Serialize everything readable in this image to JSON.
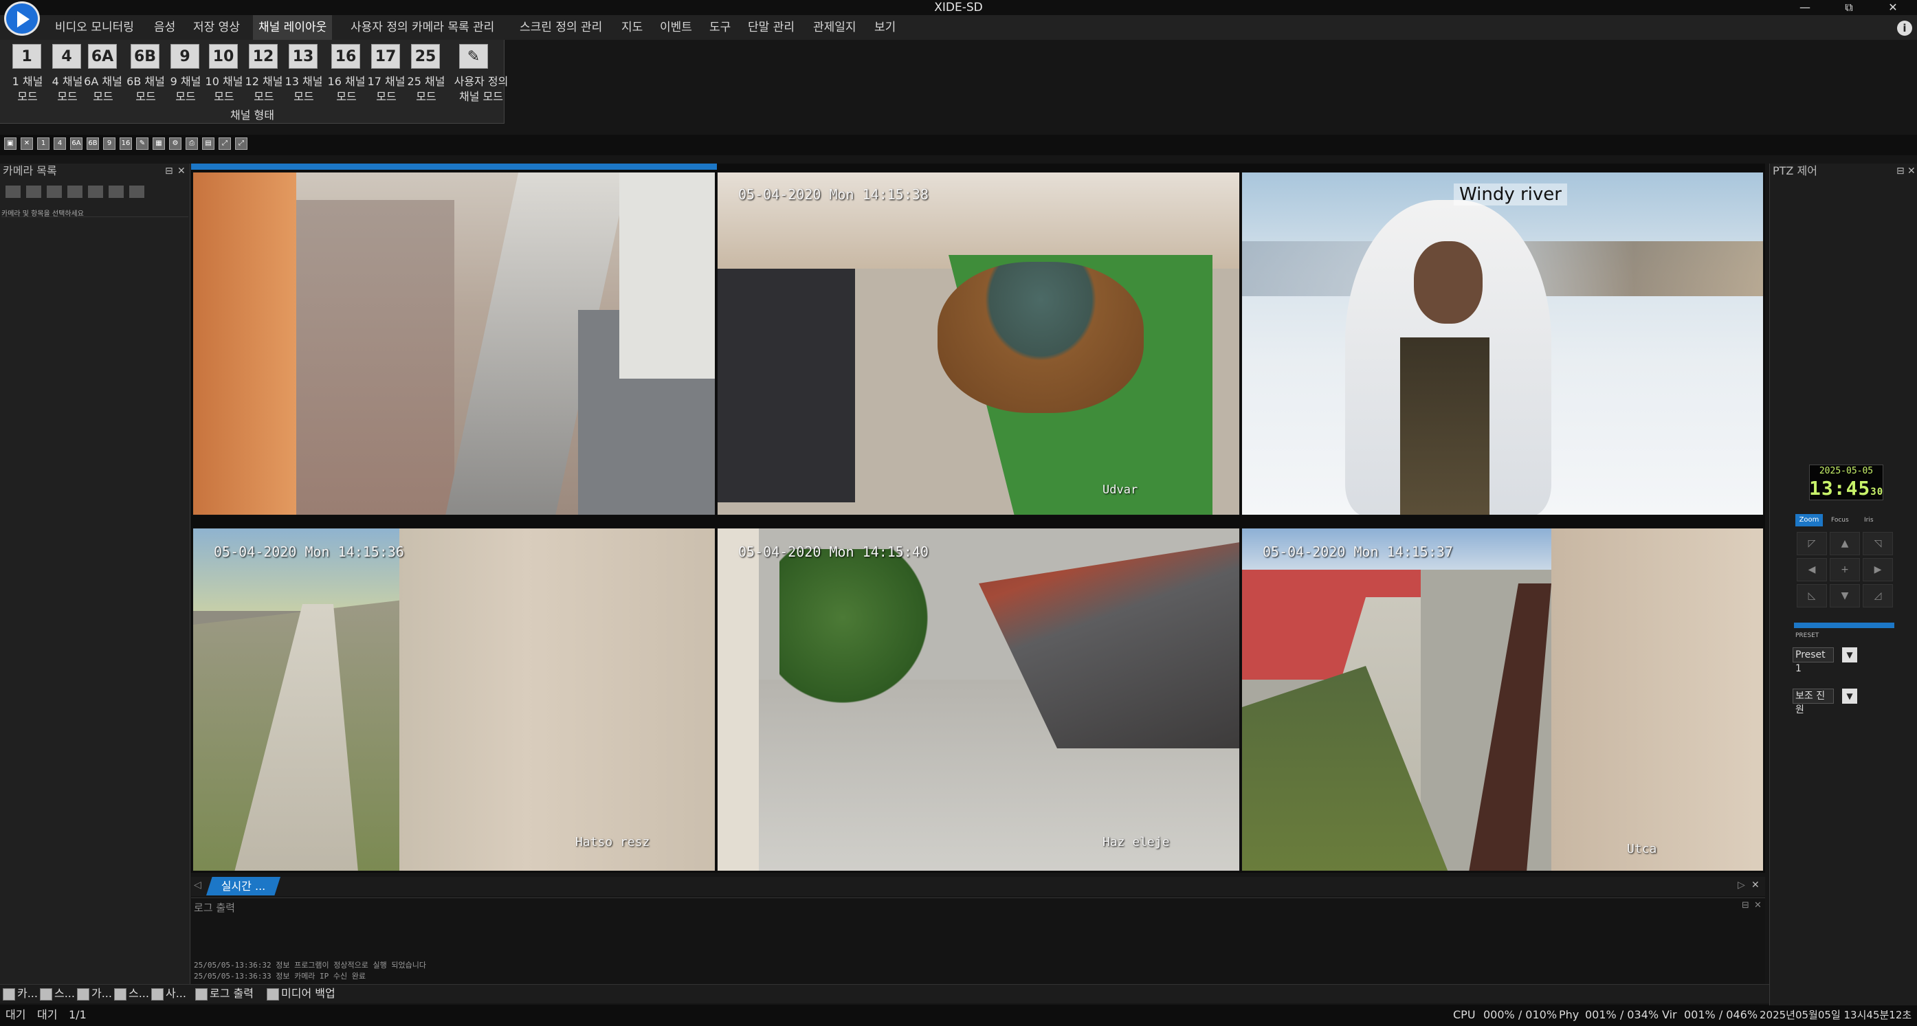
{
  "window": {
    "title": "XIDE-SD",
    "minimize": "—",
    "maximize": "⧉",
    "close": "✕"
  },
  "menu": [
    {
      "label": "비디오 모니터링"
    },
    {
      "label": "음성"
    },
    {
      "label": "저장 영상"
    },
    {
      "label": "채널 레이아웃",
      "active": true
    },
    {
      "label": "사용자 정의 카메라 목록 관리"
    },
    {
      "label": "스크린 정의 관리"
    },
    {
      "label": "지도"
    },
    {
      "label": "이벤트"
    },
    {
      "label": "도구"
    },
    {
      "label": "단말 관리"
    },
    {
      "label": "관제일지"
    },
    {
      "label": "보기"
    }
  ],
  "ribbon": {
    "buttons": [
      {
        "icon": "1",
        "line1": "1 채널",
        "line2": "모드"
      },
      {
        "icon": "4",
        "line1": "4 채널",
        "line2": "모드"
      },
      {
        "icon": "6A",
        "line1": "6A 채널",
        "line2": "모드"
      },
      {
        "icon": "6B",
        "line1": "6B 채널",
        "line2": "모드"
      },
      {
        "icon": "9",
        "line1": "9 채널",
        "line2": "모드"
      },
      {
        "icon": "10",
        "line1": "10 채널",
        "line2": "모드"
      },
      {
        "icon": "12",
        "line1": "12 채널",
        "line2": "모드"
      },
      {
        "icon": "13",
        "line1": "13 채널",
        "line2": "모드"
      },
      {
        "icon": "16",
        "line1": "16 채널",
        "line2": "모드"
      },
      {
        "icon": "17",
        "line1": "17 채널",
        "line2": "모드"
      },
      {
        "icon": "25",
        "line1": "25 채널",
        "line2": "모드"
      },
      {
        "icon": "✎",
        "line1": "사용자 정의",
        "line2": "채널 모드"
      }
    ],
    "group_label": "채널 형태"
  },
  "toolbar": [
    "▣",
    "✕",
    "1",
    "4",
    "6A",
    "6B",
    "9",
    "16",
    "✎",
    "▦",
    "⚙",
    "⎙",
    "▤",
    "⤢",
    "⤢"
  ],
  "camera_panel": {
    "title": "카메라 목록",
    "hint": "카메라 및 항목을 선택하세요"
  },
  "cameras": [
    {
      "name": "",
      "osd_time": "",
      "bg": "cam1"
    },
    {
      "name": "Udvar",
      "osd_time": "05-04-2020 Mon 14:15:38",
      "bg": "cam2"
    },
    {
      "name": "Windy river",
      "osd_time": "",
      "bg": "cam3"
    },
    {
      "name": "Hatso resz",
      "osd_time": "05-04-2020 Mon 14:15:36",
      "bg": "cam4"
    },
    {
      "name": "Haz eleje",
      "osd_time": "05-04-2020 Mon 14:15:40",
      "bg": "cam5"
    },
    {
      "name": "Utca",
      "osd_time": "05-04-2020 Mon 14:15:37",
      "bg": "cam6"
    }
  ],
  "live_tab": "실시간 ...",
  "log": {
    "title": "로그 출력",
    "lines": [
      "25/05/05-13:36:32 정보 프로그램이 정상적으로 실행 되었습니다",
      "25/05/05-13:36:33 정보 카메라 IP 수신 완료"
    ]
  },
  "bottom_tabs_left": [
    "카...",
    "스...",
    "가...",
    "스...",
    "사..."
  ],
  "bottom_tabs_log": [
    {
      "label": "로그 출력"
    },
    {
      "label": "미디어 백업"
    }
  ],
  "ptz": {
    "title": "PTZ 제어",
    "date": "2025-05-05",
    "time": "13:45",
    "seconds": "30",
    "tabs": [
      "Zoom",
      "Focus",
      "Iris"
    ],
    "preset_label": "PRESET",
    "preset_value": "Preset 1",
    "aux_value": "보조 진원"
  },
  "status": {
    "left": [
      "대기",
      "대기",
      "1/1"
    ],
    "cpu_label": "CPU",
    "cpu_value": "000% / 010%",
    "phy_label": "Phy",
    "phy_value": "001% / 034%",
    "vir_label": "Vir",
    "vir_value": "001% / 046%",
    "datetime": "2025년05월05일 13시45분12초"
  }
}
